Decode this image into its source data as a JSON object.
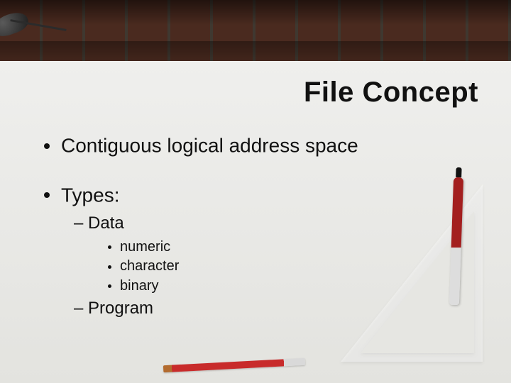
{
  "title": "File Concept",
  "bullets": {
    "item0": "Contiguous logical address space",
    "item1": "Types:",
    "types": {
      "sub0": "Data",
      "data_items": {
        "d0": "numeric",
        "d1": "character",
        "d2": "binary"
      },
      "sub1": "Program"
    }
  }
}
